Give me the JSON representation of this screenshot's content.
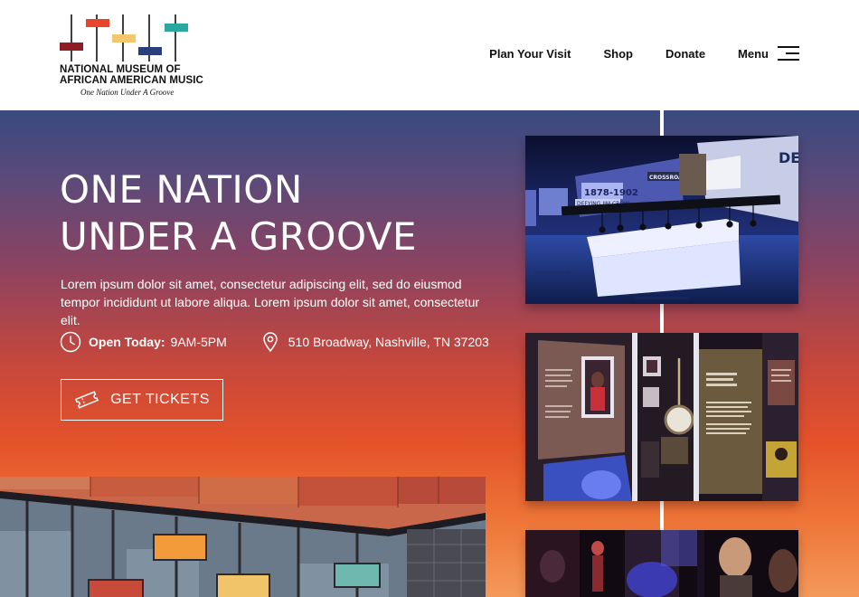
{
  "header": {
    "logo": {
      "line1": "NATIONAL MUSEUM OF",
      "line2": "AFRICAN AMERICAN MUSIC",
      "tagline": "One Nation Under A Groove",
      "colors": [
        "#8c1d23",
        "#e8452c",
        "#f2c76e",
        "#2b3f7e",
        "#2aa8a0"
      ]
    },
    "nav": {
      "plan_visit": "Plan Your Visit",
      "shop": "Shop",
      "donate": "Donate",
      "menu": "Menu",
      "menu_icon": "hamburger-icon"
    }
  },
  "hero": {
    "title_line1": "ONE NATION",
    "title_line2": "UNDER A GROOVE",
    "description": "Lorem ipsum dolor sit amet, consectetur adipiscing elit, sed do eiusmod tempor incididunt ut labore aliqua. Lorem ipsum dolor sit amet, consectetur elit.",
    "hours": {
      "label": "Open Today:",
      "value": "9AM-5PM",
      "icon": "clock-icon"
    },
    "address": {
      "value": "510 Broadway, Nashville, TN 37203",
      "icon": "location-pin-icon"
    },
    "cta": {
      "label": "GET TICKETS",
      "icon": "ticket-icon"
    },
    "gradient": [
      "#384a7f",
      "#8c4361",
      "#e4522a",
      "#f4995a"
    ]
  },
  "photos": {
    "photo1_text": {
      "year": "1878-1902",
      "caption": "DEFYING JIM CROW",
      "sign": "CROSSROADS",
      "wall": "DE"
    }
  }
}
